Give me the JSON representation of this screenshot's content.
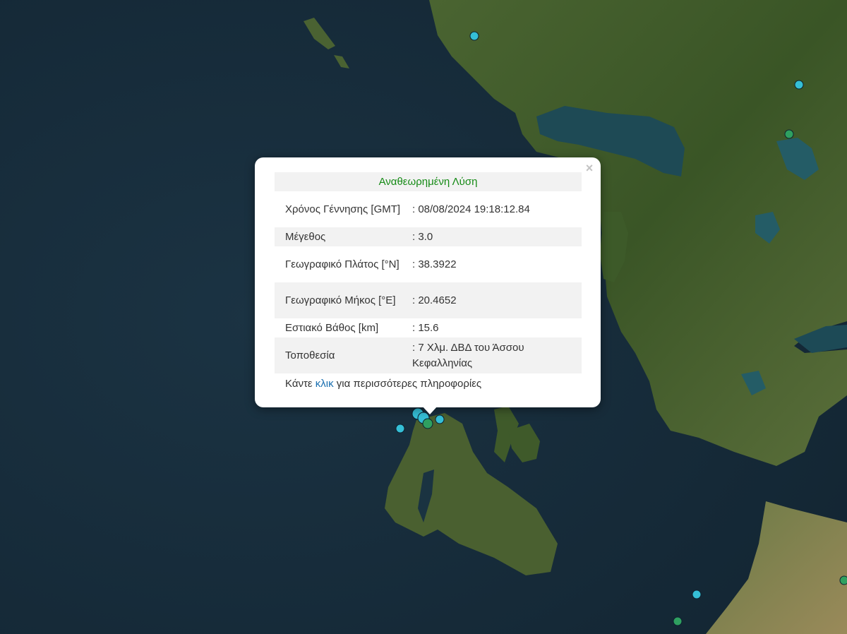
{
  "colors": {
    "sea": "#172b3a",
    "land": "#3f5a2c",
    "lake": "#1e5560",
    "marker_cyan": "#35bfd6",
    "marker_green": "#2fa060",
    "heading_green": "#158a15",
    "link_blue": "#1a6fb0"
  },
  "popup": {
    "close_glyph": "×",
    "heading": "Αναθεωρημένη Λύση",
    "rows": [
      {
        "label": "Χρόνος Γέννησης [GMT]",
        "value": ": 08/08/2024 19:18:12.84"
      },
      {
        "label": "Μέγεθος",
        "value": ": 3.0"
      },
      {
        "label": "Γεωγραφικό Πλάτος [°N]",
        "value": ": 38.3922"
      },
      {
        "label": "Γεωγραφικό Μήκος [°E]",
        "value": ": 20.4652"
      },
      {
        "label": "Εστιακό Βάθος [km]",
        "value": ": 15.6"
      },
      {
        "label": "Τοποθεσία",
        "value": ": 7 Χλμ. ΔΒΔ του Άσσου Κεφαλληνίας"
      }
    ],
    "more_before": "Κάντε ",
    "more_link": "κλικ",
    "more_after": " για περισσότερες πληροφορίες"
  },
  "markers": [
    {
      "kind": "cyan",
      "name": "earthquake-marker-north"
    },
    {
      "kind": "cyan",
      "name": "earthquake-marker-northeast"
    },
    {
      "kind": "green",
      "name": "earthquake-marker-east"
    },
    {
      "kind": "cyan",
      "name": "earthquake-marker-kefalonia-1"
    },
    {
      "kind": "cyan",
      "name": "earthquake-marker-kefalonia-2"
    },
    {
      "kind": "cyan",
      "name": "earthquake-marker-kefalonia-3"
    },
    {
      "kind": "green",
      "name": "earthquake-marker-kefalonia-selected"
    },
    {
      "kind": "cyan",
      "name": "earthquake-marker-kefalonia-4"
    },
    {
      "kind": "cyan",
      "name": "earthquake-marker-south-1"
    },
    {
      "kind": "green",
      "name": "earthquake-marker-south-2"
    },
    {
      "kind": "green",
      "name": "earthquake-marker-southeast"
    }
  ]
}
